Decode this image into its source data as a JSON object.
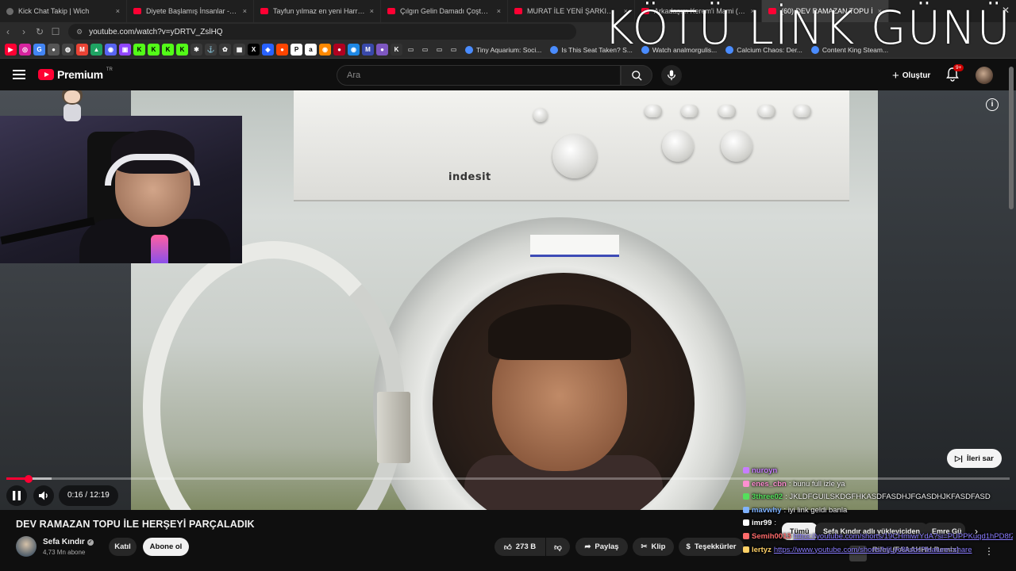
{
  "browser": {
    "tabs": [
      {
        "title": "Kick Chat Takip | Wich",
        "icon": "gray"
      },
      {
        "title": "Diyete Başlamış İnsanlar - (Tayfun Y",
        "icon": "yt"
      },
      {
        "title": "Tayfun yılmaz en yeni Harry Potter V",
        "icon": "yt"
      },
      {
        "title": "Çılgın Gelin Damadı Çoştuyor - Yo",
        "icon": "yt"
      },
      {
        "title": "MURAT İLE YENİ ŞARKIMIZ PARTA",
        "icon": "yt"
      },
      {
        "title": "Arkadaşım Kerem'i Mami (Sefa Kındı",
        "icon": "yt"
      },
      {
        "title": "(60) DEV RAMAZAN TOPU İ",
        "icon": "yt",
        "active": true
      }
    ],
    "url": "youtube.com/watch?v=yDRTV_ZslHQ",
    "bookmarks": [
      {
        "label": "Tiny Aquarium: Soci..."
      },
      {
        "label": "Is This Seat Taken? S..."
      },
      {
        "label": "Watch analmorgulis..."
      },
      {
        "label": "Calcium Chaos: Der..."
      },
      {
        "label": "Content King Steam..."
      }
    ]
  },
  "overlay_title": "KÖTÜ LİNK GÜNÜ",
  "youtube": {
    "logo_text": "Premium",
    "logo_country": "TR",
    "search_placeholder": "Ara",
    "create_label": "Oluştur",
    "notification_count": "9+"
  },
  "player": {
    "skip_label": "İleri sar",
    "time_current": "0:16",
    "time_separator": " / ",
    "time_total": "12:19",
    "progress_played_fraction": 0.022,
    "progress_buffered_fraction": 0.045,
    "brand_label": "indesit"
  },
  "chat": [
    {
      "user": "nuroyn",
      "text": "",
      "color": "#c77dff"
    },
    {
      "user": "enes_cbn",
      "text": ": bunu full izle ya",
      "color": "#ff8fd1"
    },
    {
      "user": "3three02",
      "text": ": JKLDFGUILSKDGFHKASDFASDHJFGASDHJKFASDFASD",
      "color": "#54e05c"
    },
    {
      "user": "mavwhy",
      "text": ": iyi link geldi banla",
      "color": "#7fb2ff"
    },
    {
      "user": "imr99",
      "text": ":",
      "color": "#ffffff"
    },
    {
      "user": "Semih0013",
      "text": "https://youtube.com/shorts/19CHmiwrYdA?si=PUPPKuqd1hPD8fZt",
      "color": "#ff6b6b",
      "link": true
    },
    {
      "user": "lertyz",
      "text": "https://www.youtube.com/shorts/hljLyc8ksbc?feature=share",
      "color": "#ffd166",
      "link": true
    }
  ],
  "video": {
    "title": "DEV RAMAZAN TOPU İLE HERŞEYİ PARÇALADIK",
    "channel": "Sefa Kındır",
    "subscribers": "4,73 Mn abone",
    "join_label": "Katıl",
    "subscribe_label": "Abone ol",
    "likes": "273 B",
    "share_label": "Paylaş",
    "clip_label": "Klip",
    "thanks_label": "Teşekkürler"
  },
  "sidebar": {
    "chips": [
      "Tümü",
      "Sefa Kındır adlı yükleyiciden",
      "Emre Gü"
    ],
    "first_recommendation": "Riley (FAAAHHH Remix)"
  }
}
